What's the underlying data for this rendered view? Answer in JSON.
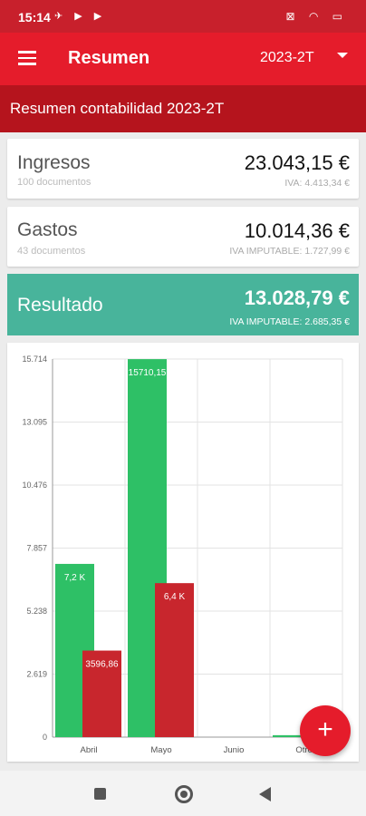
{
  "status_bar": {
    "time": "15:14",
    "left_icons": "✈ ▶ ▶",
    "right_icons": "⊠ ◠ ▭"
  },
  "toolbar": {
    "title": "Resumen",
    "period": "2023-2T"
  },
  "banner": {
    "title": "Resumen contabilidad 2023-2T"
  },
  "ingresos": {
    "label": "Ingresos",
    "documents": "100 documentos",
    "amount": "23.043,15 €",
    "iva": "IVA: 4.413,34 €"
  },
  "gastos": {
    "label": "Gastos",
    "documents": "43 documentos",
    "amount": "10.014,36 €",
    "iva": "IVA IMPUTABLE: 1.727,99 €"
  },
  "resultado": {
    "label": "Resultado",
    "amount": "13.028,79 €",
    "iva": "IVA IMPUTABLE: 2.685,35 €"
  },
  "fab": {
    "label": "+"
  },
  "chart_data": {
    "type": "bar",
    "categories": [
      "Abril",
      "Mayo",
      "Junio",
      "Otros"
    ],
    "y_ticks": [
      "0",
      "2.619",
      "5.238",
      "7.857",
      "10.476",
      "13.095",
      "15.714"
    ],
    "ylim": [
      0,
      15714
    ],
    "grid": true,
    "series": [
      {
        "values": [
          7200,
          15710.15,
          0,
          80
        ],
        "labels": [
          "7,2 K",
          "15710,15",
          "",
          ""
        ],
        "color": "#2ec066"
      },
      {
        "values": [
          3596.86,
          6400,
          0,
          0
        ],
        "labels": [
          "3596,86",
          "6,4 K",
          "",
          ""
        ],
        "color": "#c8262d"
      }
    ]
  },
  "colors": {
    "accent": "#e51c2b",
    "banner": "#b5141d",
    "result": "#48b49b"
  }
}
